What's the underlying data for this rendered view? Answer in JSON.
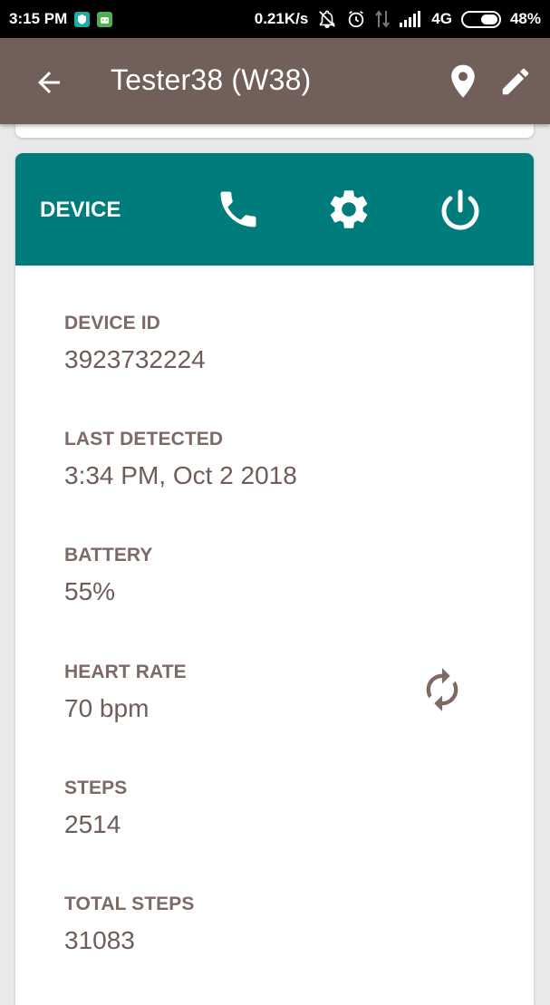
{
  "status_bar": {
    "time": "3:15 PM",
    "network_speed": "0.21K/s",
    "network_type": "4G",
    "battery": "48%",
    "icons": [
      "shield-app-icon",
      "android-app-icon",
      "notifications-off-icon",
      "alarm-icon",
      "data-arrows-icon",
      "signal-icon"
    ]
  },
  "app_bar": {
    "title": "Tester38 (W38)",
    "icons": [
      "back-arrow-icon",
      "location-pin-icon",
      "edit-pencil-icon"
    ],
    "color": "#715f5a"
  },
  "device_card": {
    "title": "DEVICE",
    "header_color": "#007c7c",
    "actions": [
      "phone-icon",
      "gear-icon",
      "power-icon"
    ],
    "fields": [
      {
        "label": "DEVICE ID",
        "value": "3923732224"
      },
      {
        "label": "LAST DETECTED",
        "value": "3:34 PM, Oct 2 2018"
      },
      {
        "label": "BATTERY",
        "value": "55%"
      },
      {
        "label": "HEART RATE",
        "value": "70 bpm"
      },
      {
        "label": "STEPS",
        "value": "2514"
      },
      {
        "label": "TOTAL STEPS",
        "value": "31083"
      }
    ],
    "refresh_icon": "refresh-icon"
  }
}
